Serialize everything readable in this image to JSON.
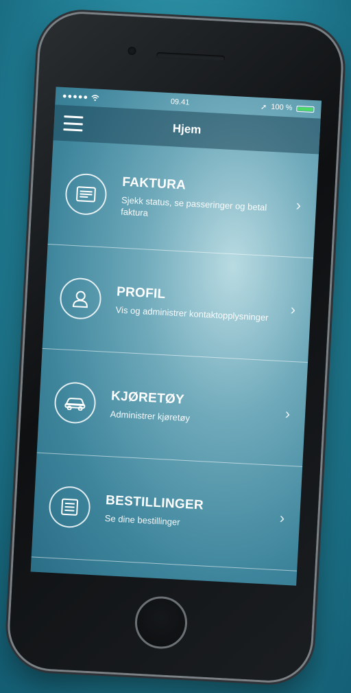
{
  "status_bar": {
    "signal": "●●●●● ",
    "wifi_icon": "wifi-icon",
    "time": "09.41",
    "location_icon": "➚",
    "battery_text": "100 %",
    "battery_level": 1.0
  },
  "navbar": {
    "title": "Hjem",
    "menu_icon": "hamburger-icon"
  },
  "menu": [
    {
      "icon": "invoice-icon",
      "title": "FAKTURA",
      "subtitle": "Sjekk status, se passeringer og betal faktura",
      "chevron": "›"
    },
    {
      "icon": "user-icon",
      "title": "PROFIL",
      "subtitle": "Vis og administrer kontaktopplysninger",
      "chevron": "›"
    },
    {
      "icon": "car-icon",
      "title": "KJØRETØY",
      "subtitle": "Administrer kjøretøy",
      "chevron": "›"
    },
    {
      "icon": "list-icon",
      "title": "BESTILLINGER",
      "subtitle": "Se dine bestillinger",
      "chevron": "›"
    }
  ],
  "colors": {
    "background": "#227f95",
    "battery_fill": "#4cd964",
    "text": "#ffffff"
  }
}
